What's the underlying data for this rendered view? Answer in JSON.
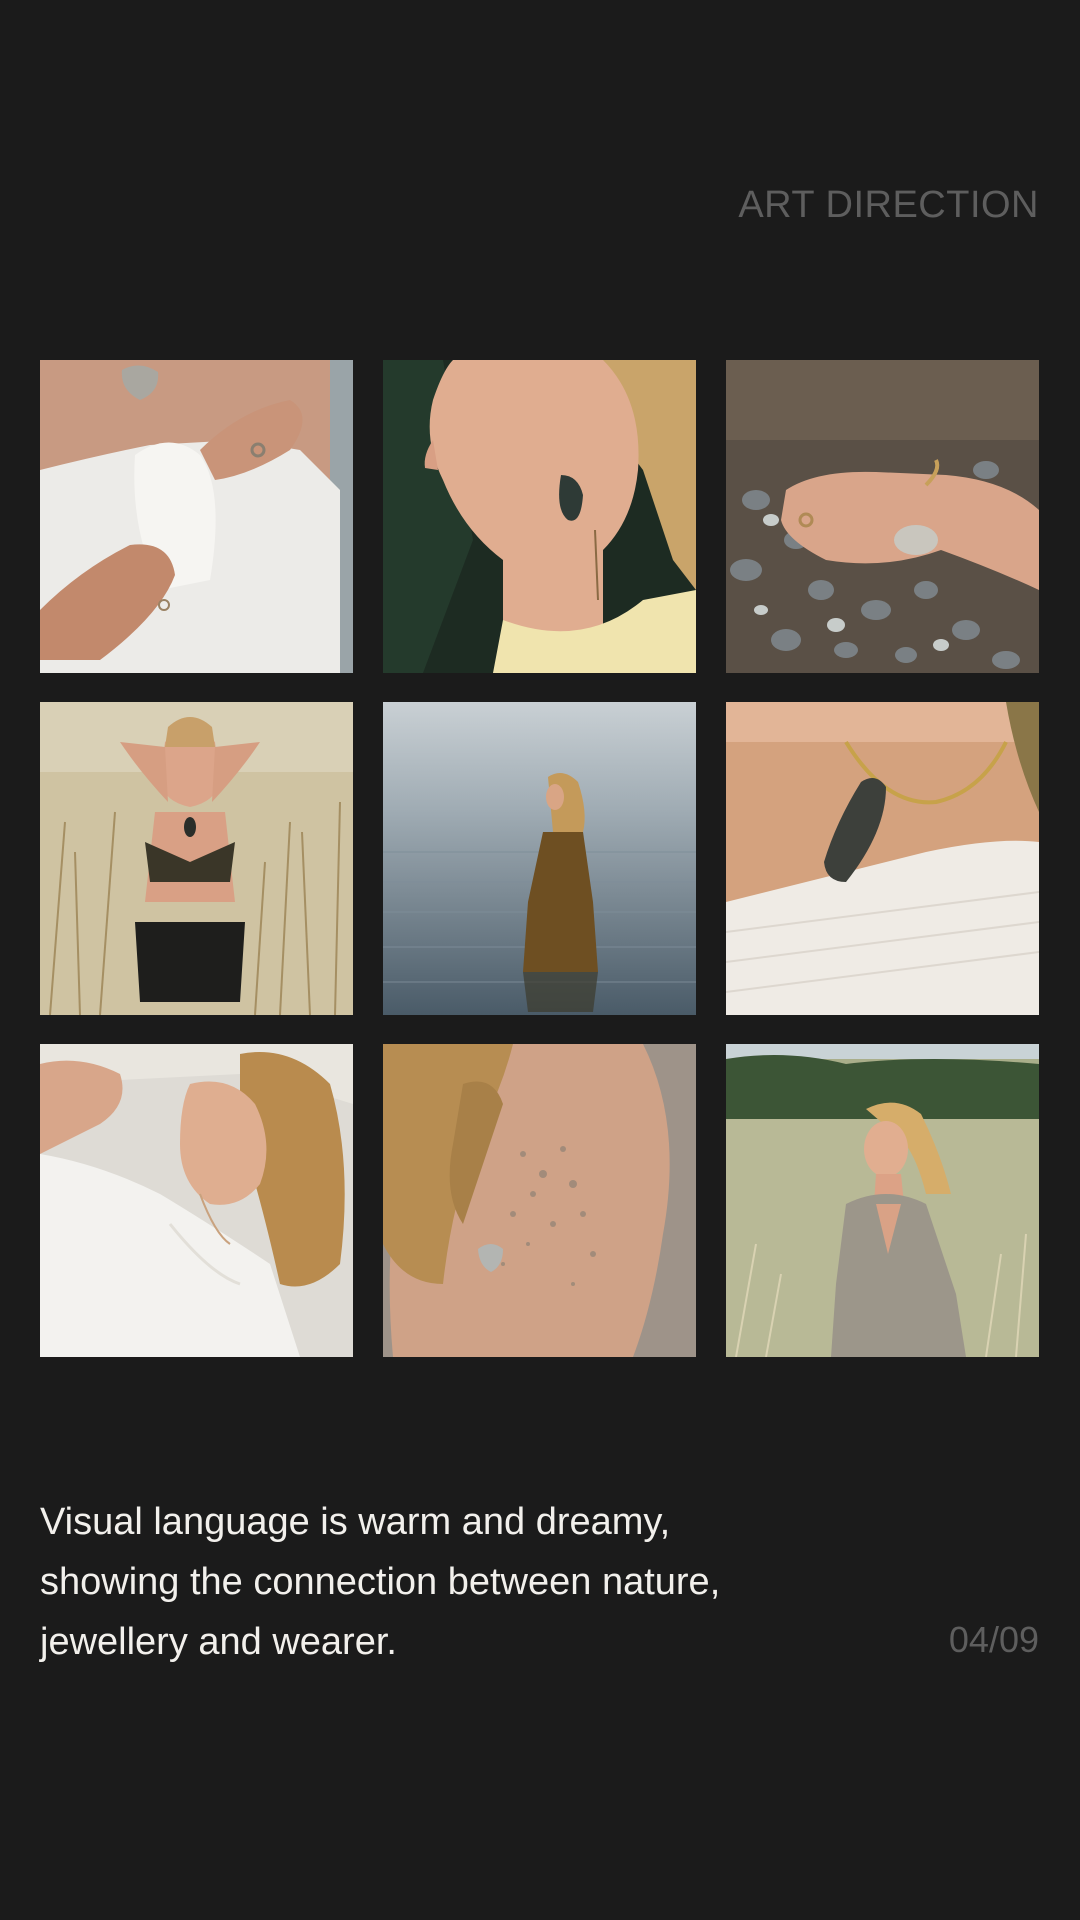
{
  "section_title": "ART DIRECTION",
  "gallery": {
    "tiles": [
      {
        "icon": "photo-torso-stone-pendant-icon"
      },
      {
        "icon": "photo-profile-earring-icon"
      },
      {
        "icon": "photo-hand-pebbles-bracelet-icon"
      },
      {
        "icon": "photo-woman-in-grass-icon"
      },
      {
        "icon": "photo-woman-in-water-icon"
      },
      {
        "icon": "photo-neck-stone-collar-icon"
      },
      {
        "icon": "photo-woman-lying-icon"
      },
      {
        "icon": "photo-back-stone-pendant-icon"
      },
      {
        "icon": "photo-woman-in-meadow-icon"
      }
    ]
  },
  "caption": "Visual language is warm and dreamy, showing the connection between nature, jewellery and wearer.",
  "pager": "04/09",
  "colors": {
    "background": "#1b1b1b",
    "muted_text": "#5e5e5e",
    "body_text": "#f2f0ec"
  }
}
